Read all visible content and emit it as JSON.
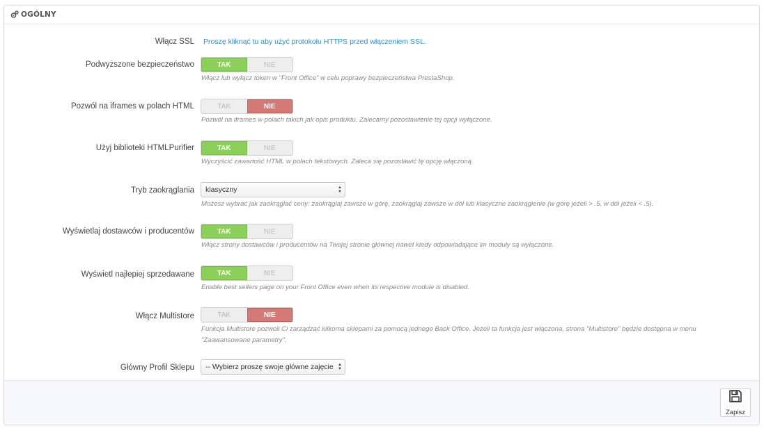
{
  "panel": {
    "title": "OGÓLNY",
    "title_icon": "cogs-icon"
  },
  "fields": {
    "ssl": {
      "label": "Włącz SSL",
      "link": "Proszę kliknąć tu aby użyć protokołu HTTPS przed włączeniem SSL."
    },
    "token": {
      "label": "Podwyższone bezpieczeństwo",
      "yes": "TAK",
      "no": "NIE",
      "value": "TAK",
      "help": "Włącz lub wyłącz token w \"Front Office\" w celu poprawy bezpieczeństwa PrestaShop."
    },
    "iframes": {
      "label": "Pozwól na iframes w polach HTML",
      "yes": "TAK",
      "no": "NIE",
      "value": "NIE",
      "help": "Pozwól na iframes w polach takich jak opis produktu. Zalecamy pozostawienie tej opcji wyłączone."
    },
    "purifier": {
      "label": "Użyj biblioteki HTMLPurifier",
      "yes": "TAK",
      "no": "NIE",
      "value": "TAK",
      "help": "Wyczyścić zawartość HTML w polach tekstowych. Zaleca się pozostawić tę opcję włączoną."
    },
    "rounding": {
      "label": "Tryb zaokrąglania",
      "selected": "klasyczny",
      "help": "Możesz wybrać jak zaokrąglać ceny: zaokrąglaj zawsze w górę, zaokrąglaj zawsze w dół lub klasyczne zaokrąglenie (w górę jeżeli > .5, w dół jeżeli < .5)."
    },
    "suppliers": {
      "label": "Wyświetlaj dostawców i producentów",
      "yes": "TAK",
      "no": "NIE",
      "value": "TAK",
      "help": "Włącz strony dostawców i producentów na Twojej stronie głównej nawet kiedy odpowiadające im moduły są wyłączone."
    },
    "bestsellers": {
      "label": "Wyświetl najlepiej sprzedawane",
      "yes": "TAK",
      "no": "NIE",
      "value": "TAK",
      "help": "Enable best sellers page on your Front Office even when its respective module is disabled."
    },
    "multistore": {
      "label": "Włącz Multistore",
      "yes": "TAK",
      "no": "NIE",
      "value": "NIE",
      "help_line1": "Funkcja Multistore pozwoli Ci zarządzać kilkoma sklepami za pomocą jednego Back Office. Jeżeli ta funkcja jest włączona, strona \"Multistore\" będzie dostępna w menu",
      "help_line2": "\"Zaawansowane parametry\"."
    },
    "shop_profile": {
      "label": "Główny Profil Sklepu",
      "selected": "-- Wybierz proszę swoje główne zajęcie"
    }
  },
  "footer": {
    "save_label": "Zapisz",
    "save_icon": "floppy-disk-icon"
  },
  "colors": {
    "yes_active": "#8dcf5b",
    "no_active": "#d47a76",
    "link": "#2e8dcc"
  }
}
